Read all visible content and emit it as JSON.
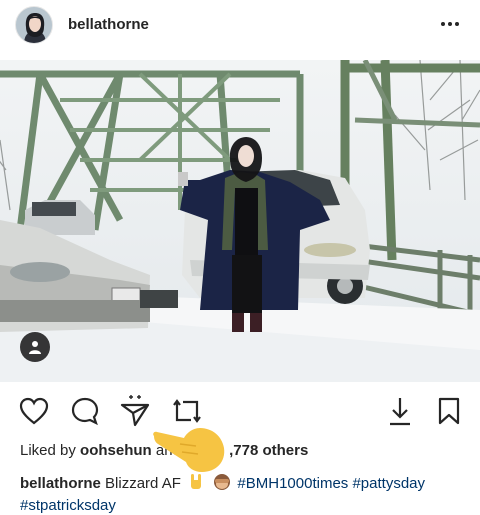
{
  "post": {
    "username": "bellathorne",
    "liked_by_prefix": "Liked by",
    "liked_by_user": "oohsehun",
    "liked_by_mid": "and",
    "liked_by_count": ",778 others",
    "caption_user": "bellathorne",
    "caption_text": "Blizzard AF",
    "hashtags": [
      "#BMH1000times",
      "#pattysday",
      "#stpatricksday"
    ]
  },
  "icons": {
    "more": "more-dots-icon",
    "like": "heart-icon",
    "comment": "comment-icon",
    "share": "send-icon",
    "repost": "repost-icon",
    "save": "bookmark-icon",
    "download": "download-icon",
    "tag": "user-tag-icon"
  },
  "colors": {
    "text": "#262626",
    "hashtag": "#003569",
    "hand": "#f6c443"
  }
}
